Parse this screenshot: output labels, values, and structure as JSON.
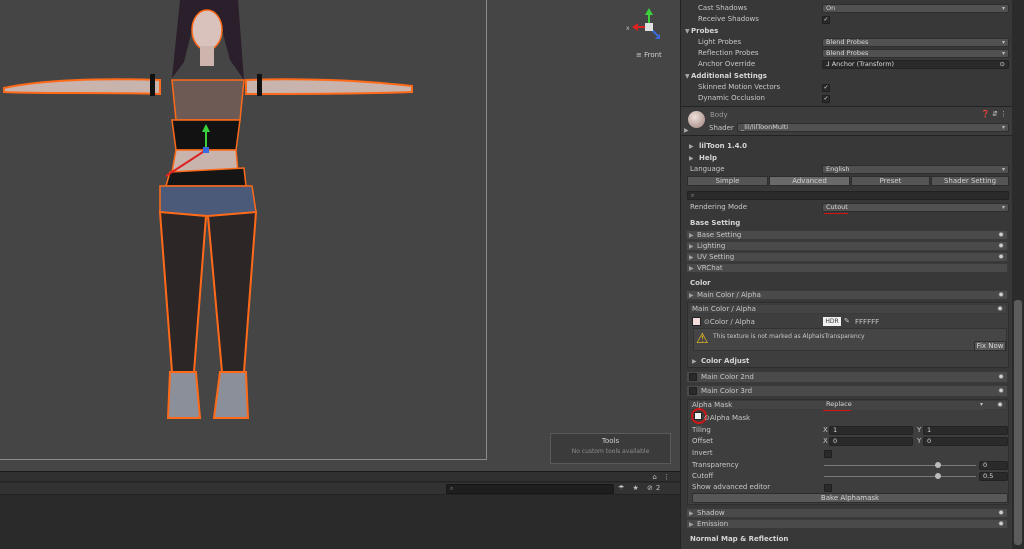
{
  "scene": {
    "view_label": "Front",
    "gizmo_axis": "x",
    "tools_title": "Tools",
    "tools_subtitle": "No custom tools available",
    "bottom_icons": "⌂ ⋮",
    "bottom_right": "☂ ★ ⊘2",
    "bottom_search_icon": "⌕"
  },
  "inspector": {
    "cast_shadows_label": "Cast Shadows",
    "cast_shadows_value": "On",
    "receive_shadows_label": "Receive Shadows",
    "probes_header": "Probes",
    "light_probes_label": "Light Probes",
    "light_probes_value": "Blend Probes",
    "reflection_probes_label": "Reflection Probes",
    "reflection_probes_value": "Blend Probes",
    "anchor_override_label": "Anchor Override",
    "anchor_override_value": "⅃ Anchor (Transform)",
    "additional_header": "Additional Settings",
    "skinned_label": "Skinned Motion Vectors",
    "dynamic_occlusion_label": "Dynamic Occlusion",
    "material_name": "Body",
    "shader_label": "Shader",
    "shader_value": "_lil/lilToonMulti",
    "liltoon_version": "lilToon 1.4.0",
    "help": "Help",
    "language_label": "Language",
    "language_value": "English",
    "tabs": [
      "Simple",
      "Advanced",
      "Preset",
      "Shader Setting"
    ],
    "rendering_mode_label": "Rendering Mode",
    "rendering_mode_value": "Cutout",
    "base_setting_header": "Base Setting",
    "base_groups": [
      "Base Setting",
      "Lighting",
      "UV Setting",
      "VRChat"
    ],
    "color_header": "Color",
    "main_color_group": "Main Color / Alpha",
    "main_color_sub": "Main Color / Alpha",
    "color_alpha_label": "Color / Alpha",
    "hdr": "HDR",
    "hex": "FFFFFF",
    "warning": "This texture is not marked as AlphaIsTransparency",
    "fix_now": "Fix Now",
    "color_adjust": "Color Adjust",
    "main_color_2nd": "Main Color 2nd",
    "main_color_3rd": "Main Color 3rd",
    "alpha_mask_label": "Alpha Mask",
    "alpha_mask_value": "Replace",
    "alpha_mask_tex": "Alpha Mask",
    "tiling_label": "Tiling",
    "tiling_x": "1",
    "tiling_y": "1",
    "offset_label": "Offset",
    "offset_x": "0",
    "offset_y": "0",
    "x": "X",
    "y": "Y",
    "invert_label": "Invert",
    "transparency_label": "Transparency",
    "transparency_value": "0",
    "cutoff_label": "Cutoff",
    "cutoff_value": "0.5",
    "show_advanced_label": "Show advanced editor",
    "bake_button": "Bake Alphamask",
    "shadow": "Shadow",
    "emission": "Emission",
    "normal_header": "Normal Map & Reflection"
  },
  "sliders": {
    "transparency": 0.0,
    "cutoff": 0.5
  },
  "colors": {
    "accent_red": "#d21414",
    "selection_orange": "#ff6a1a"
  }
}
